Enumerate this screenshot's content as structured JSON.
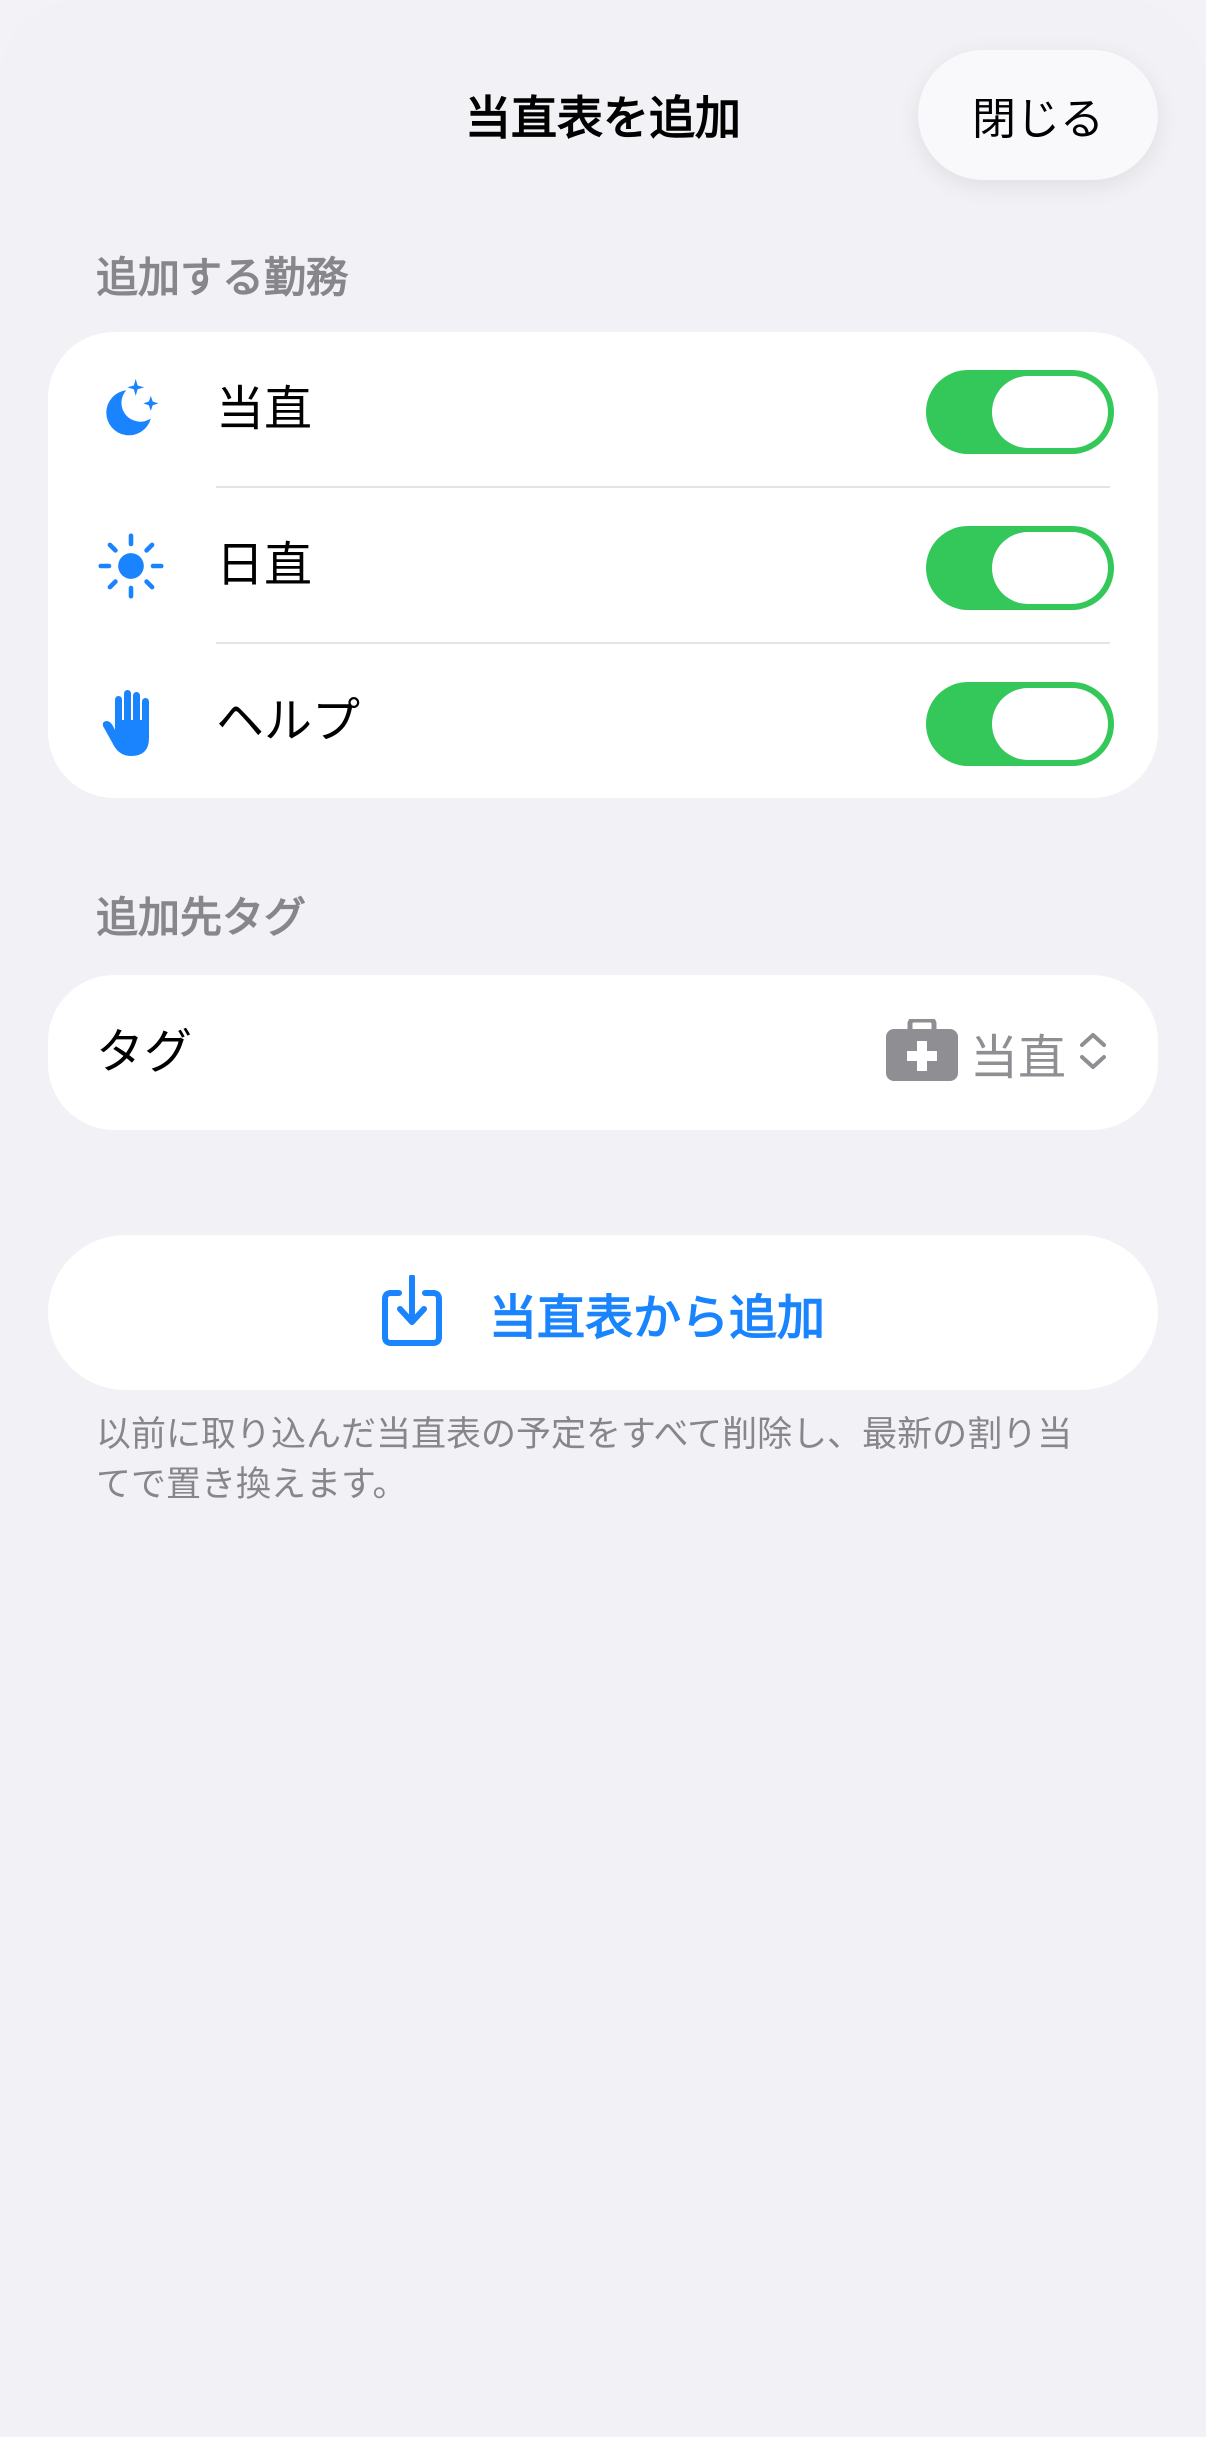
{
  "header": {
    "title": "当直表を追加",
    "close_label": "閉じる"
  },
  "duties_section": {
    "header": "追加する勤務",
    "items": [
      {
        "label": "当直",
        "icon": "moon-stars-icon",
        "enabled": true
      },
      {
        "label": "日直",
        "icon": "sun-icon",
        "enabled": true
      },
      {
        "label": "ヘルプ",
        "icon": "hand-raised-icon",
        "enabled": true
      }
    ]
  },
  "tag_section": {
    "header": "追加先タグ",
    "label": "タグ",
    "value": "当直",
    "value_icon": "medical-case-icon",
    "chevron_icon": "chevron-up-down-icon"
  },
  "action": {
    "label": "当直表から追加",
    "icon": "download-tray-icon",
    "footnote": "以前に取り込んだ当直表の予定をすべて削除し、最新の割り当てで置き換えます。"
  },
  "colors": {
    "accent": "#1a84ff",
    "toggle_on": "#34c759",
    "secondary_text": "#86868b",
    "background": "#f1f1f6"
  }
}
